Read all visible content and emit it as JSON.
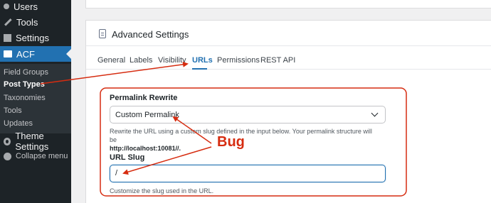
{
  "sidebar": {
    "items": [
      {
        "label": "Users",
        "icon": "users-icon"
      },
      {
        "label": "Tools",
        "icon": "wrench-icon"
      },
      {
        "label": "Settings",
        "icon": "settings-icon"
      },
      {
        "label": "ACF",
        "icon": "acf-icon"
      }
    ],
    "submenu": [
      {
        "label": "Field Groups"
      },
      {
        "label": "Post Types"
      },
      {
        "label": "Taxonomies"
      },
      {
        "label": "Tools"
      },
      {
        "label": "Updates"
      }
    ],
    "bottom": [
      {
        "label": "Theme Settings",
        "icon": "gear-icon"
      },
      {
        "label": "Collapse menu",
        "icon": "collapse-icon"
      }
    ]
  },
  "panel": {
    "title": "Advanced Settings",
    "tabs": [
      {
        "label": "General"
      },
      {
        "label": "Labels"
      },
      {
        "label": "Visibility"
      },
      {
        "label": "URLs"
      },
      {
        "label": "Permissions"
      },
      {
        "label": "REST API"
      }
    ],
    "active_tab": "URLs"
  },
  "permalink": {
    "label": "Permalink Rewrite",
    "value": "Custom Permalink",
    "description_pre": "Rewrite the URL using a custom slug defined in the input below. Your permalink structure will be",
    "description_url": "http://localhost:10081//."
  },
  "slug": {
    "label": "URL Slug",
    "value": "/",
    "description": "Customize the slug used in the URL."
  },
  "annotation": {
    "label": "Bug",
    "color": "#d62c10"
  },
  "colors": {
    "sidebar_bg": "#1d2327",
    "accent": "#2271b1",
    "annotation": "#d62c10"
  }
}
